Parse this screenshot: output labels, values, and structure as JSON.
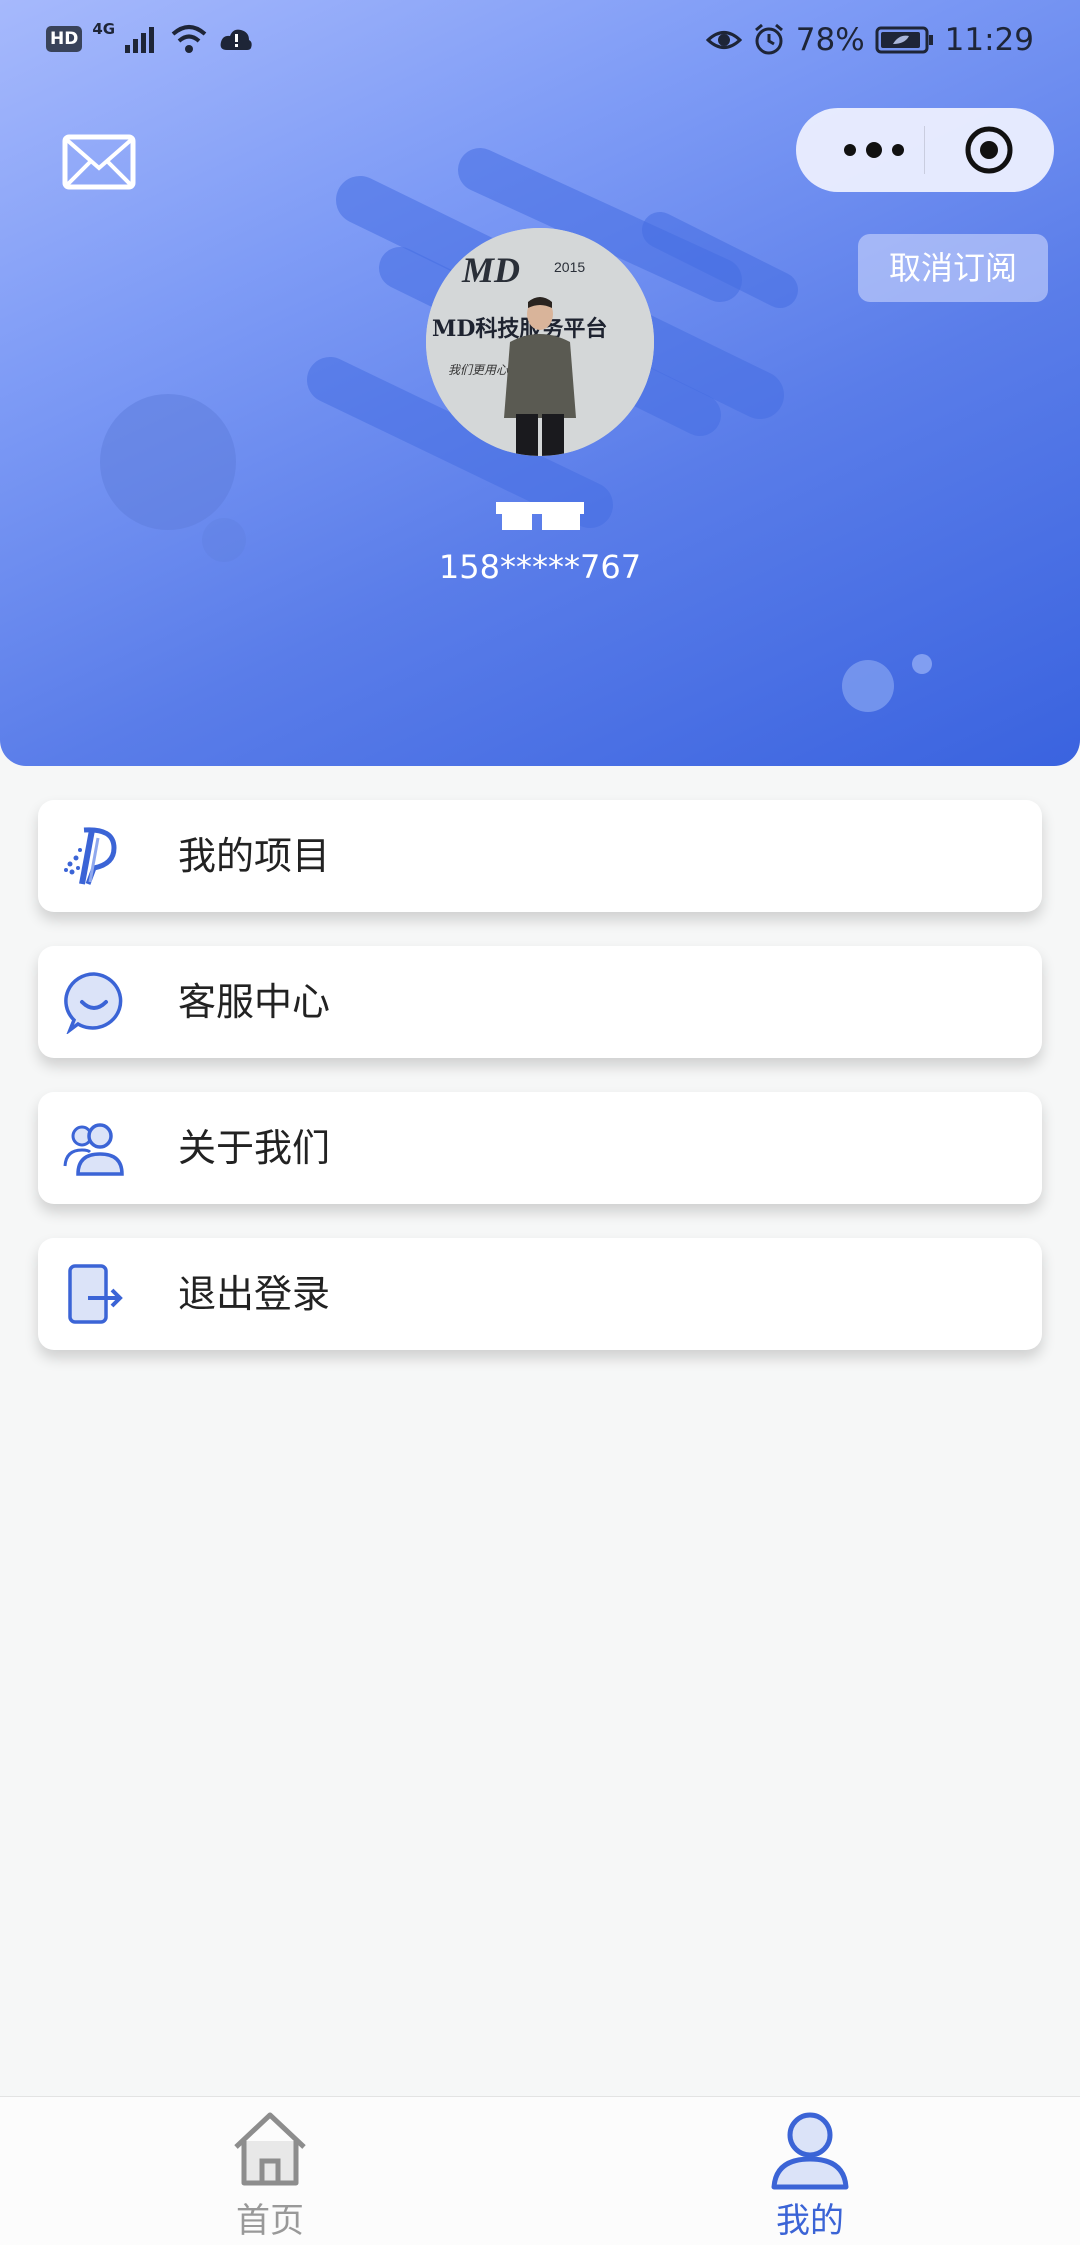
{
  "status_bar": {
    "hd": "HD",
    "network": "4G",
    "battery_percent": "78%",
    "time": "11:29"
  },
  "header": {
    "unsubscribe_label": "取消订阅",
    "phone": "158*****767",
    "colors": {
      "gradient_start": "#a6b9fc",
      "gradient_end": "#3a63df"
    }
  },
  "avatar": {
    "logo_text": "MD",
    "logo_year": "2015",
    "banner_text": "MD科技服务平台",
    "slogan": "我们更用心"
  },
  "menu": [
    {
      "label": "我的项目",
      "icon": "project-logo-icon"
    },
    {
      "label": "客服中心",
      "icon": "smile-chat-icon"
    },
    {
      "label": "关于我们",
      "icon": "users-icon"
    },
    {
      "label": "退出登录",
      "icon": "logout-icon"
    }
  ],
  "tabbar": {
    "tabs": [
      {
        "label": "首页",
        "icon": "home-icon",
        "active": false
      },
      {
        "label": "我的",
        "icon": "user-icon",
        "active": true
      }
    ],
    "colors": {
      "active": "#3b64d6",
      "inactive": "#999999"
    }
  },
  "accent_color": "#3b64d6"
}
